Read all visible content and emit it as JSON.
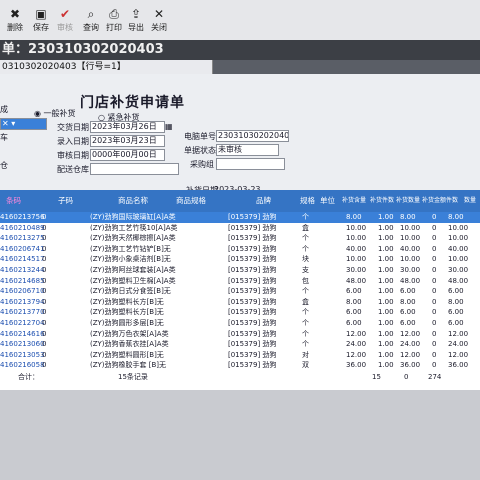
{
  "toolbar": {
    "buttons": [
      "删除",
      "保存",
      "审核",
      "查询",
      "打印",
      "导出",
      "关闭"
    ]
  },
  "doc": {
    "number_label": "单：230310302020403"
  },
  "tab": {
    "label": "0310302020403【行号=1】"
  },
  "form": {
    "heading": "门店补货申请单",
    "radio_general": "一般补货",
    "radio_urgent": "紧急补货",
    "partial_label_1": "成",
    "partial_label_2": "车",
    "partial_label_3": "仓",
    "delivery_date_label": "交货日期",
    "delivery_date_value": "2023年03月26日",
    "entry_date_label": "录入日期",
    "entry_date_value": "2023年03月23日",
    "audit_date_label": "审核日期",
    "audit_date_value": "0000年00月00日",
    "warehouse_label": "配送仓库",
    "computer_no_label": "电脑单号",
    "computer_no_value": "230310302020403",
    "status_label": "单据状态",
    "status_value": "未审核",
    "purchase_group_label": "采购组",
    "replenish_date_label": "补货日期",
    "replenish_date_value": "2023-03-23"
  },
  "grid": {
    "headers": [
      "条码",
      "子码",
      "商品名称",
      "商品规格",
      "品牌",
      "规格",
      "单位",
      "补货含量",
      "补货件数",
      "补货数量",
      "补货金额",
      "件数",
      "数量"
    ],
    "rows": [
      {
        "code": "4160213756",
        "sub": "0",
        "name": "(ZY)劲狗国际玻璃缸[A]A类",
        "brand": "[015379] 劲狗",
        "unit": "个",
        "qty": "8.00",
        "n1": "1.00",
        "n2": "8.00",
        "c": "0",
        "d": "8.00"
      },
      {
        "code": "4160210489",
        "sub": "0",
        "name": "(ZY)劲狗工艺竹筷10[A]A类",
        "brand": "[015379] 劲狗",
        "unit": "盒",
        "qty": "10.00",
        "n1": "1.00",
        "n2": "10.00",
        "c": "0",
        "d": "10.00"
      },
      {
        "code": "4160213275",
        "sub": "0",
        "name": "(ZY)劲狗天然椰棕擦[A]A类",
        "brand": "[015379] 劲狗",
        "unit": "个",
        "qty": "10.00",
        "n1": "1.00",
        "n2": "10.00",
        "c": "0",
        "d": "10.00"
      },
      {
        "code": "4160206741",
        "sub": "0",
        "name": "(ZY)劲狗工艺竹钻铲[B]无",
        "brand": "[015379] 劲狗",
        "unit": "个",
        "qty": "40.00",
        "n1": "1.00",
        "n2": "40.00",
        "c": "0",
        "d": "40.00"
      },
      {
        "code": "4160214517",
        "sub": "0",
        "name": "(ZY)劲狗小象桌洁剂[B]无",
        "brand": "[015379] 劲狗",
        "unit": "块",
        "qty": "10.00",
        "n1": "1.00",
        "n2": "10.00",
        "c": "0",
        "d": "10.00"
      },
      {
        "code": "4160213244",
        "sub": "0",
        "name": "(ZY)劲狗阿丝球套装[A]A类",
        "brand": "[015379] 劲狗",
        "unit": "支",
        "qty": "30.00",
        "n1": "1.00",
        "n2": "30.00",
        "c": "0",
        "d": "30.00"
      },
      {
        "code": "4160214685",
        "sub": "0",
        "name": "(ZY)劲狗塑料卫生棉[A]A类",
        "brand": "[015379] 劲狗",
        "unit": "包",
        "qty": "48.00",
        "n1": "1.00",
        "n2": "48.00",
        "c": "0",
        "d": "48.00"
      },
      {
        "code": "4160206710",
        "sub": "0",
        "name": "(ZY)劲狗日式分食签[B]无",
        "brand": "[015379] 劲狗",
        "unit": "个",
        "qty": "6.00",
        "n1": "1.00",
        "n2": "6.00",
        "c": "0",
        "d": "6.00"
      },
      {
        "code": "4160213794",
        "sub": "0",
        "name": "(ZY)劲狗塑料长方[B]无",
        "brand": "[015379] 劲狗",
        "unit": "盒",
        "qty": "8.00",
        "n1": "1.00",
        "n2": "8.00",
        "c": "0",
        "d": "8.00"
      },
      {
        "code": "4160213770",
        "sub": "0",
        "name": "(ZY)劲狗塑料长方[B]无",
        "brand": "[015379] 劲狗",
        "unit": "个",
        "qty": "6.00",
        "n1": "1.00",
        "n2": "6.00",
        "c": "0",
        "d": "6.00"
      },
      {
        "code": "4160212704",
        "sub": "0",
        "name": "(ZY)劲狗圆形多层[B]无",
        "brand": "[015379] 劲狗",
        "unit": "个",
        "qty": "6.00",
        "n1": "1.00",
        "n2": "6.00",
        "c": "0",
        "d": "6.00"
      },
      {
        "code": "4160214616",
        "sub": "0",
        "name": "(ZY)劲狗万色衣架[A]A类",
        "brand": "[015379] 劲狗",
        "unit": "个",
        "qty": "12.00",
        "n1": "1.00",
        "n2": "12.00",
        "c": "0",
        "d": "12.00"
      },
      {
        "code": "4160213060",
        "sub": "0",
        "name": "(ZY)劲狗香蕉衣挂[A]A类",
        "brand": "[015379] 劲狗",
        "unit": "个",
        "qty": "24.00",
        "n1": "1.00",
        "n2": "24.00",
        "c": "0",
        "d": "24.00"
      },
      {
        "code": "4160213053",
        "sub": "0",
        "name": "(ZY)劲狗塑料圆形[B]无",
        "brand": "[015379] 劲狗",
        "unit": "对",
        "qty": "12.00",
        "n1": "1.00",
        "n2": "12.00",
        "c": "0",
        "d": "12.00"
      },
      {
        "code": "4160216058",
        "sub": "0",
        "name": "(ZY)劲狗橡胶手套 [B]无",
        "brand": "[015379] 劲狗",
        "unit": "双",
        "qty": "36.00",
        "n1": "1.00",
        "n2": "36.00",
        "c": "0",
        "d": "36.00"
      }
    ],
    "total_label": "合计：",
    "total_records": "15条记录",
    "total_n1": "15",
    "total_c": "0",
    "total_d": "274"
  }
}
